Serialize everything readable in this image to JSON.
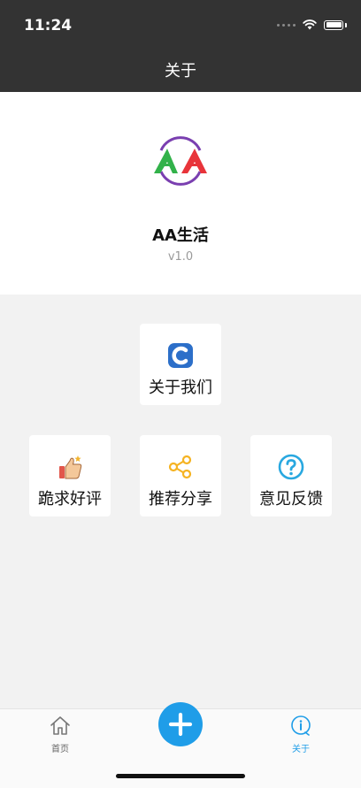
{
  "status_bar": {
    "time": "11:24"
  },
  "nav": {
    "title": "关于"
  },
  "about": {
    "app_name": "AA生活",
    "version": "v1.0",
    "logo_text": "AA"
  },
  "tiles": [
    {
      "label": "关于我们",
      "icon": "about-us-icon"
    },
    {
      "label": "跪求好评",
      "icon": "thumbs-up-icon"
    },
    {
      "label": "推荐分享",
      "icon": "share-icon"
    },
    {
      "label": "意见反馈",
      "icon": "feedback-icon"
    }
  ],
  "tabbar": {
    "home_label": "首页",
    "about_label": "关于",
    "add_icon": "plus-icon",
    "active_color": "#1f9de8",
    "inactive_color": "#666666"
  },
  "colors": {
    "nav_bg": "#333333",
    "accent": "#1f9de8"
  }
}
